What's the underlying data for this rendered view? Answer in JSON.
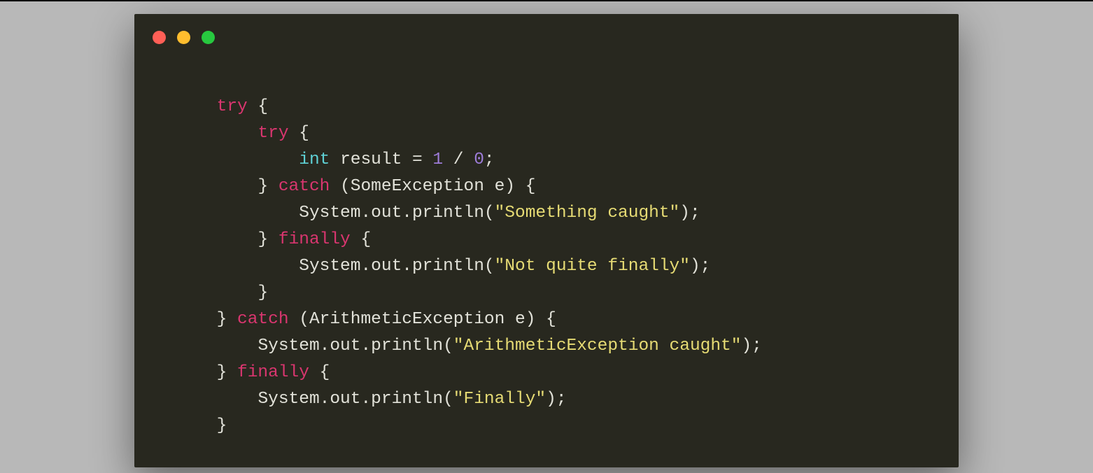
{
  "colors": {
    "bg": "#b8b8b8",
    "window_bg": "#28281f",
    "dot_red": "#ff5f56",
    "dot_yellow": "#ffbd2e",
    "dot_green": "#27c93f",
    "keyword": "#d9366f",
    "type": "#5fd1d5",
    "number": "#9d7cd8",
    "string": "#e6db74",
    "default": "#e2e2d9"
  },
  "code": {
    "indent0": "        ",
    "indent1": "            ",
    "indent2": "                ",
    "kw_try": "try",
    "kw_catch": "catch",
    "kw_finally": "finally",
    "type_int": "int",
    "ident_result": "result",
    "op_eq": " = ",
    "num_1": "1",
    "op_div": " / ",
    "num_0": "0",
    "semi": ";",
    "lbrace": " {",
    "rbrace": "}",
    "rbrace_sp": "} ",
    "lparen": " (",
    "rparen": ") ",
    "type_SomeException": "SomeException",
    "type_ArithmeticException": "ArithmeticException",
    "ident_e": " e",
    "call_sys": "System",
    "call_out": ".out",
    "call_println": ".println(",
    "rparen_semi": ");",
    "str_something_caught": "\"Something caught\"",
    "str_not_quite_finally": "\"Not quite finally\"",
    "str_arith_caught": "\"ArithmeticException caught\"",
    "str_finally": "\"Finally\""
  }
}
